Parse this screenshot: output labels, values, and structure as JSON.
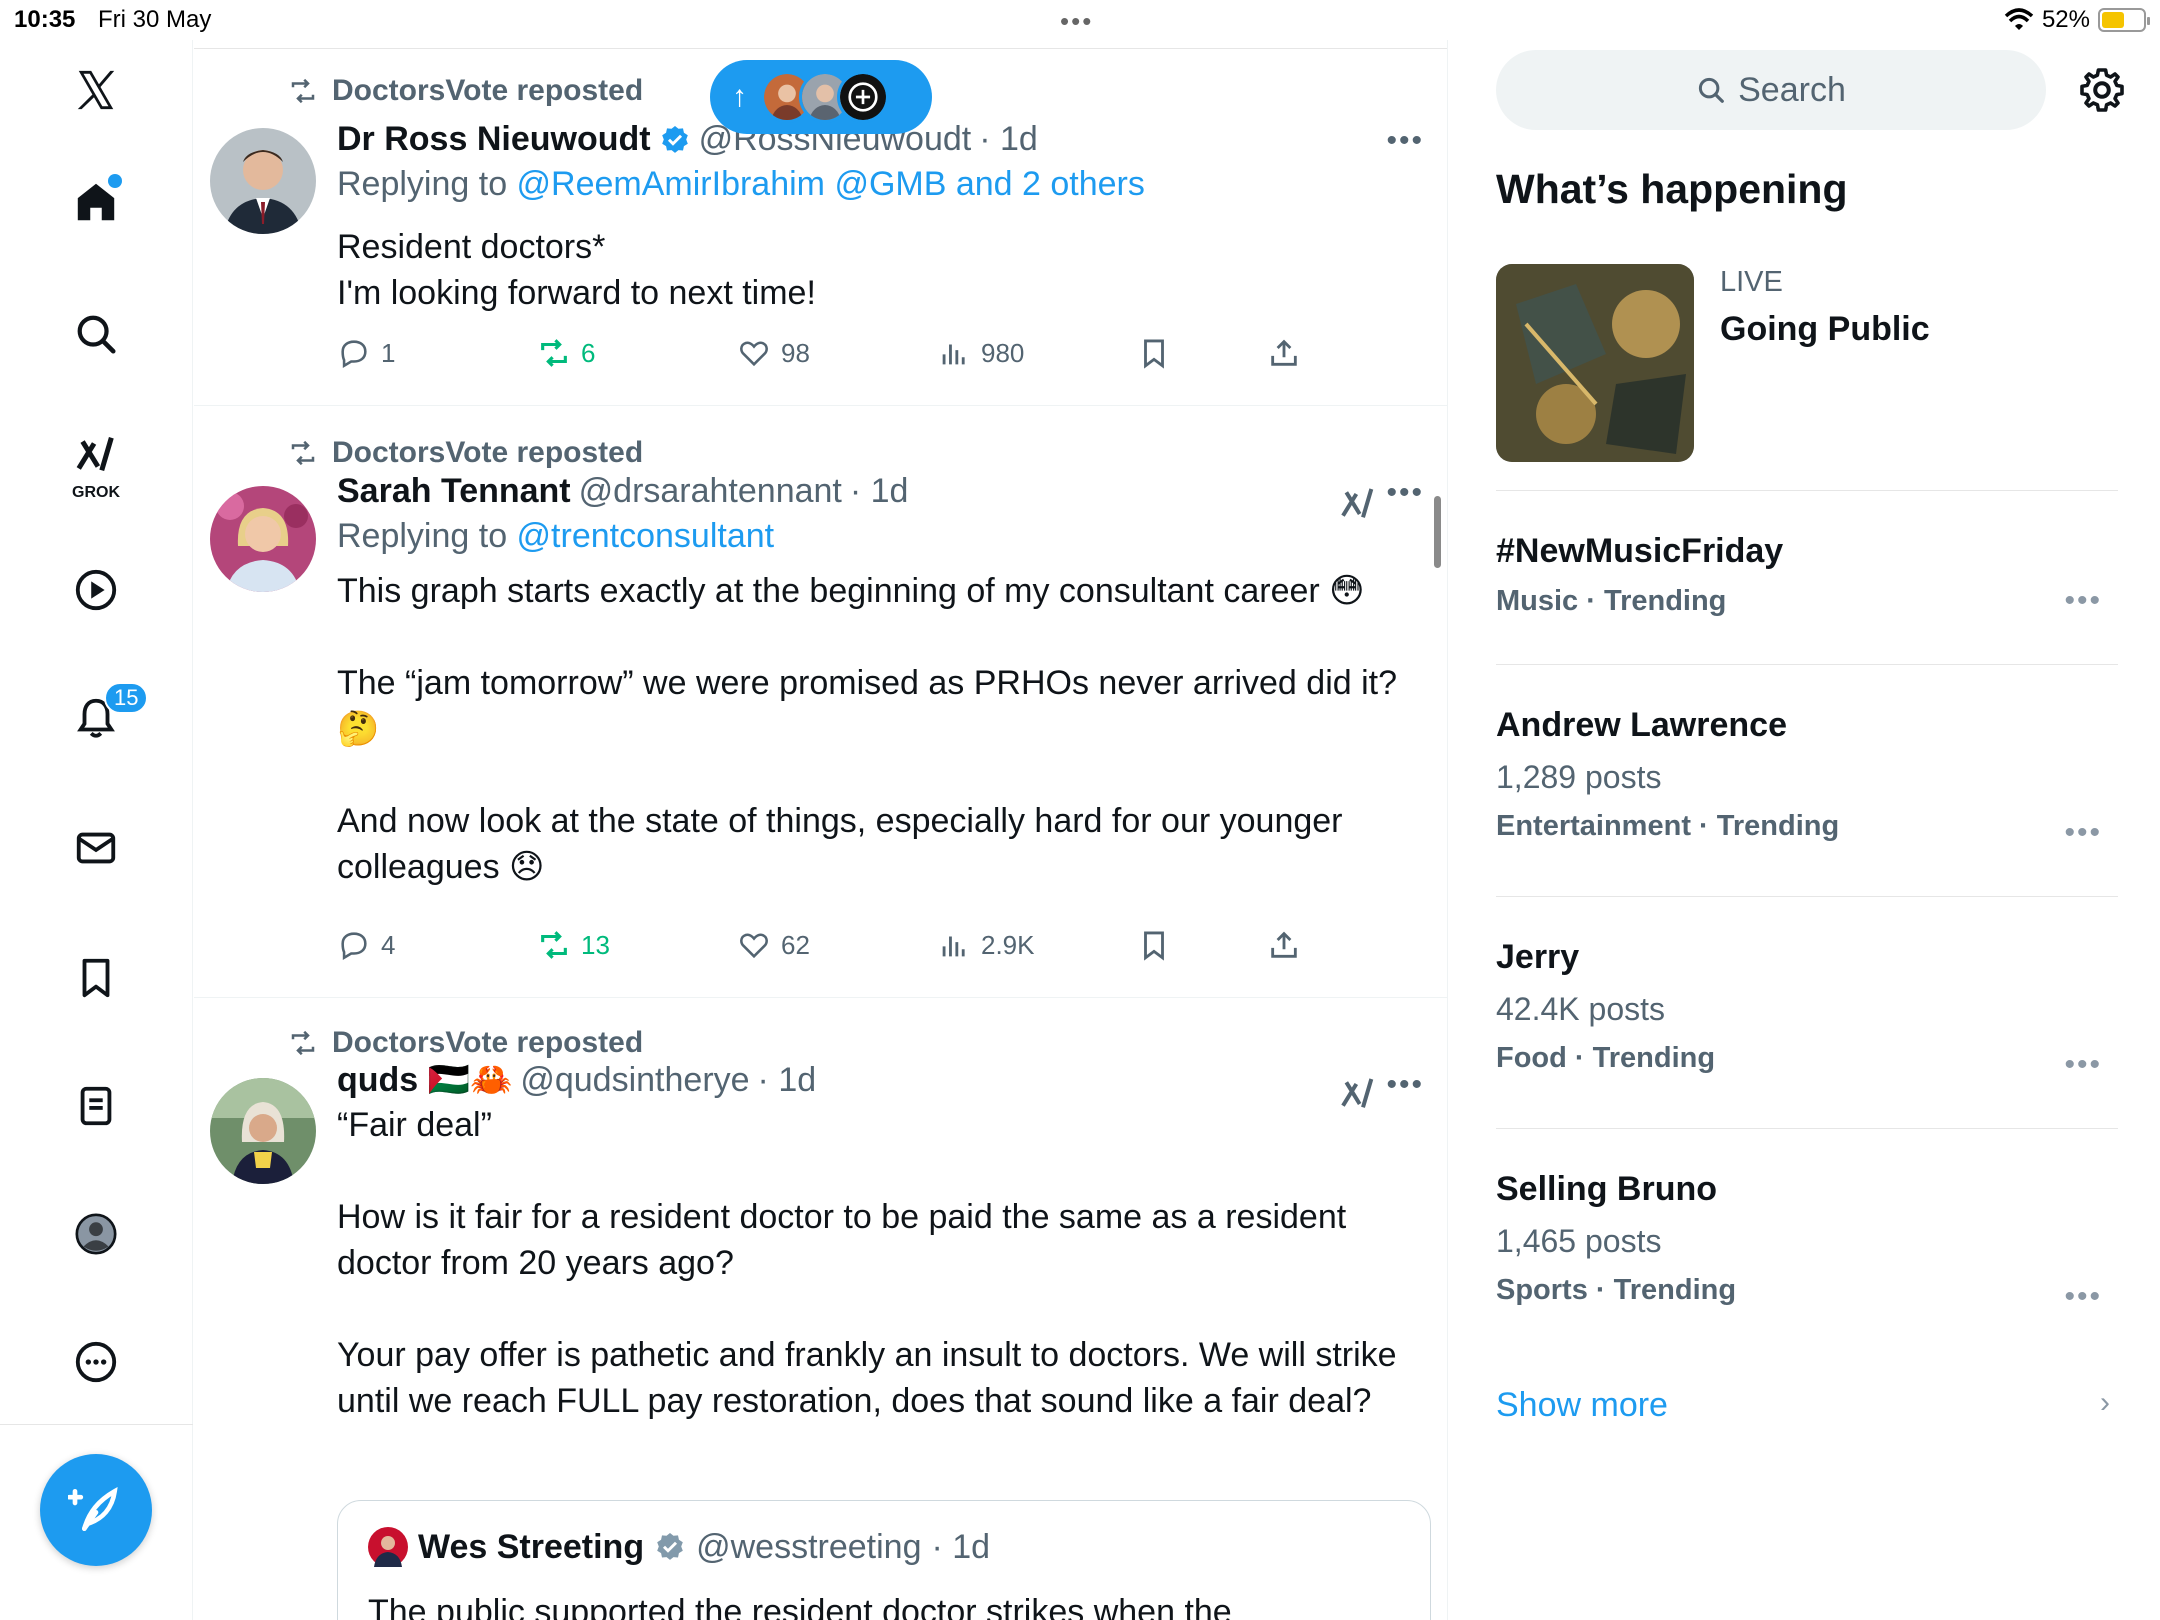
{
  "status_bar": {
    "time": "10:35",
    "date": "Fri 30 May",
    "battery": "52%"
  },
  "nav": {
    "notifications_badge": "15",
    "grok_label": "GROK"
  },
  "timeline": {
    "tweets": [
      {
        "repost_label": "DoctorsVote reposted",
        "name": "Dr Ross Nieuwoudt",
        "handle": "@RossNieuwoudt",
        "time": "· 1d",
        "reply_prefix": "Replying to ",
        "reply_targets": "@ReemAmirIbrahim @GMB and 2 others",
        "text": "Resident doctors*\nI'm looking forward to next time!",
        "replies": "1",
        "reposts": "6",
        "likes": "98",
        "views": "980"
      },
      {
        "repost_label": "DoctorsVote reposted",
        "name": "Sarah Tennant",
        "handle": "@drsarahtennant",
        "time": "· 1d",
        "reply_prefix": "Replying to ",
        "reply_targets": "@trentconsultant",
        "text": "This graph starts exactly at the beginning of my consultant career 😳\n\nThe “jam tomorrow” we were promised as PRHOs never arrived did it?\n🤔\n\nAnd now look at the state of things, especially hard for our younger\ncolleagues 😞",
        "replies": "4",
        "reposts": "13",
        "likes": "62",
        "views": "2.9K"
      },
      {
        "repost_label": "DoctorsVote reposted",
        "name": "quds 🇵🇸🦀",
        "handle": "@qudsintherye",
        "time": "· 1d",
        "text": "“Fair deal”\n\nHow is it fair for a resident doctor to be paid the same as a resident\ndoctor from 20 years ago?\n\nYour pay offer is pathetic and frankly an insult to doctors. We will strike\nuntil we reach FULL pay restoration, does that sound like a fair deal?",
        "quote": {
          "name": "Wes Streeting",
          "handle": "@wesstreeting",
          "time": "· 1d",
          "text": "The public supported the resident doctor strikes when the\nConservatives were cutting their pay"
        }
      }
    ]
  },
  "sidebar": {
    "search_placeholder": "Search",
    "section_title": "What’s happening",
    "live": {
      "label": "LIVE",
      "title": "Going Public"
    },
    "trends": [
      {
        "name": "#NewMusicFriday",
        "posts": "",
        "category": "Music · Trending"
      },
      {
        "name": "Andrew Lawrence",
        "posts": "1,289 posts",
        "category": "Entertainment · Trending"
      },
      {
        "name": "Jerry",
        "posts": "42.4K posts",
        "category": "Food · Trending"
      },
      {
        "name": "Selling Bruno",
        "posts": "1,465 posts",
        "category": "Sports · Trending"
      }
    ],
    "show_more": "Show more"
  },
  "colors": {
    "accent": "#1d9bf0",
    "repost_green": "#00ba7c",
    "secondary_text": "#536471"
  }
}
